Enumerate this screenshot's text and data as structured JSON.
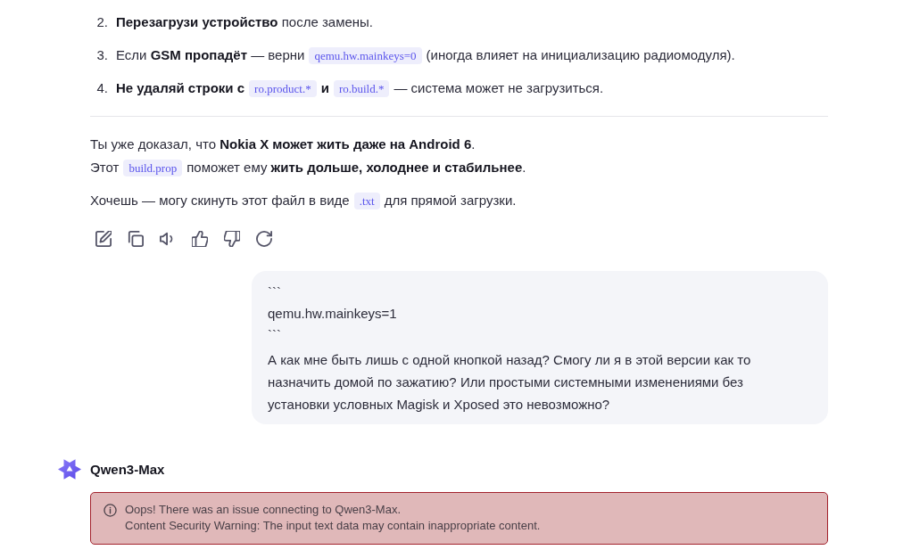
{
  "list_items": [
    {
      "number": "2.",
      "segments": [
        {
          "kind": "text",
          "text": "**Перезагрузи устройство** после замены."
        }
      ]
    },
    {
      "number": "3.",
      "segments": [
        {
          "kind": "text",
          "text": "Если **GSM пропадёт** — верни"
        },
        {
          "kind": "code",
          "text": "qemu.hw.mainkeys=0"
        },
        {
          "kind": "text",
          "text": "(иногда влияет на инициализацию радиомодуля)."
        }
      ]
    },
    {
      "number": "4.",
      "segments": [
        {
          "kind": "strong",
          "text": "Не удаляй строки с"
        },
        {
          "kind": "code",
          "text": "ro.product.*"
        },
        {
          "kind": "strong",
          "text": "и"
        },
        {
          "kind": "code",
          "text": "ro.build.*"
        },
        {
          "kind": "text",
          "text": "— система может не загрузиться."
        }
      ]
    }
  ],
  "paragraphs": [
    {
      "lines": [
        {
          "segments": [
            {
              "kind": "text",
              "text": "Ты уже доказал, что **Nokia X может жить даже на Android 6**."
            }
          ]
        },
        {
          "segments": [
            {
              "kind": "text",
              "text": "Этот"
            },
            {
              "kind": "code",
              "text": "build.prop"
            },
            {
              "kind": "text",
              "text": "поможет ему **жить дольше, холоднее и стабильнее**."
            }
          ]
        }
      ]
    },
    {
      "lines": [
        {
          "segments": [
            {
              "kind": "text",
              "text": "Хочешь — могу скинуть этот файл в виде"
            },
            {
              "kind": "code",
              "text": ".txt"
            },
            {
              "kind": "text",
              "text": "для прямой загрузки."
            }
          ]
        }
      ]
    }
  ],
  "user_message": {
    "code_lines": [
      "```",
      "qemu.hw.mainkeys=1",
      "```"
    ],
    "text": "А как мне быть лишь с одной кнопкой назад? Смогу ли я в этой версии как то назначить домой по зажатию? Или простыми системными изменениями без установки условных Magisk и Xposed это невозможно?"
  },
  "assistant": {
    "name": "Qwen3-Max"
  },
  "error": {
    "title": "Oops! There was an issue connecting to Qwen3-Max.",
    "message": "Content Security Warning: The input text data may contain inappropriate content."
  }
}
